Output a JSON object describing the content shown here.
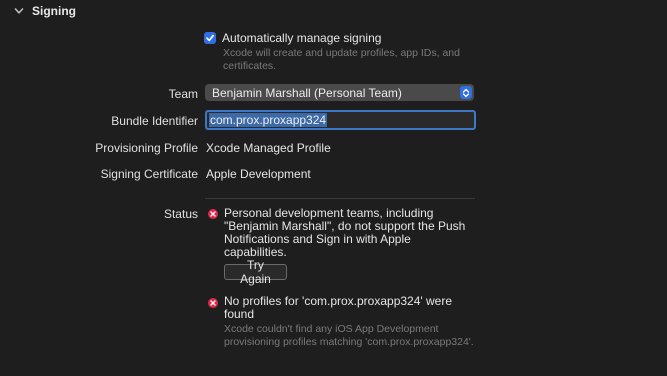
{
  "section": {
    "title": "Signing",
    "icon": "chevron-down-icon"
  },
  "auto_signing": {
    "checked": true,
    "label": "Automatically manage signing",
    "help": "Xcode will create and update profiles, app IDs, and certificates."
  },
  "team": {
    "label": "Team",
    "value": "Benjamin Marshall (Personal Team)"
  },
  "bundle_identifier": {
    "label": "Bundle Identifier",
    "value": "com.prox.proxapp324"
  },
  "provisioning_profile": {
    "label": "Provisioning Profile",
    "value": "Xcode Managed Profile"
  },
  "signing_certificate": {
    "label": "Signing Certificate",
    "value": "Apple Development"
  },
  "status": {
    "label": "Status",
    "errors": [
      {
        "message": "Personal development teams, including \"Benjamin Marshall\", do not support the Push Notifications and Sign in with Apple capabilities.",
        "button": "Try Again"
      },
      {
        "message": "No profiles for 'com.prox.proxapp324' were found",
        "detail": "Xcode couldn't find any iOS App Development provisioning profiles matching 'com.prox.proxapp324'."
      }
    ]
  },
  "colors": {
    "background": "#1e1e1e",
    "accent": "#2f6fe2",
    "error": "#e0294b",
    "secondary_text": "#7a7a7a"
  }
}
